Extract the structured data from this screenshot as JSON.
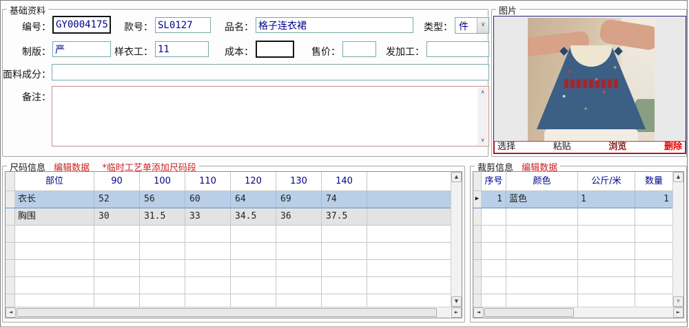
{
  "basic": {
    "title": "基础资料",
    "bianhao_label": "编号：",
    "bianhao_value": "GY0004175",
    "kuanhao_label": "款号：",
    "kuanhao_value": "SL0127",
    "pinming_label": "品名：",
    "pinming_value": "格子连衣裙",
    "leixing_label": "类型：",
    "leixing_value": "件",
    "zhiban_label": "制版：",
    "zhiban_value": "严",
    "yangyigong_label": "样衣工：",
    "yangyigong_value": "11",
    "chengben_label": "成本：",
    "chengben_value": "",
    "shoujia_label": "售价：",
    "shoujia_value": "",
    "fajiagong_label": "发加工：",
    "fajiagong_value": "",
    "mianliao_label": "面料成分：",
    "mianliao_value": "",
    "beizhu_label": "备注：",
    "beizhu_value": ""
  },
  "picture": {
    "title": "图片",
    "select_label": "选择",
    "paste_label": "粘贴",
    "browse_label": "浏览",
    "delete_label": "删除"
  },
  "size_info": {
    "title": "尺码信息",
    "edit_link": "编辑数据",
    "note": "*临时工艺单添加尺码段",
    "columns": [
      "部位",
      "90",
      "100",
      "110",
      "120",
      "130",
      "140"
    ],
    "rows": [
      {
        "part": "衣长",
        "v0": "52",
        "v1": "56",
        "v2": "60",
        "v3": "64",
        "v4": "69",
        "v5": "74"
      },
      {
        "part": "胸围",
        "v0": "30",
        "v1": "31.5",
        "v2": "33",
        "v3": "34.5",
        "v4": "36",
        "v5": "37.5"
      }
    ]
  },
  "cutting_info": {
    "title": "裁剪信息",
    "edit_link": "编辑数据",
    "columns": [
      "序号",
      "颜色",
      "公斤/米",
      "数量"
    ],
    "rows": [
      {
        "no": "1",
        "color": "蓝色",
        "kg_per_m": "1",
        "qty": "1"
      }
    ]
  },
  "icons": {
    "combo_chevron": "∨",
    "scroll_up": "▲",
    "scroll_down": "▼",
    "scroll_left": "◄",
    "scroll_right": "►",
    "textarea_up": "∧",
    "textarea_down": "∨",
    "row_marker": "▶"
  },
  "colors": {
    "field_border_teal": "#79a8a8",
    "value_text_navy": "#00008b",
    "link_red": "#cc2222",
    "browse_dark_red": "#8b1a1a",
    "delete_red": "#e60000",
    "selected_row_blue": "#b9cfe8",
    "photo_frame_navy": "#26267e",
    "remark_border_pink": "#c98b8b"
  }
}
